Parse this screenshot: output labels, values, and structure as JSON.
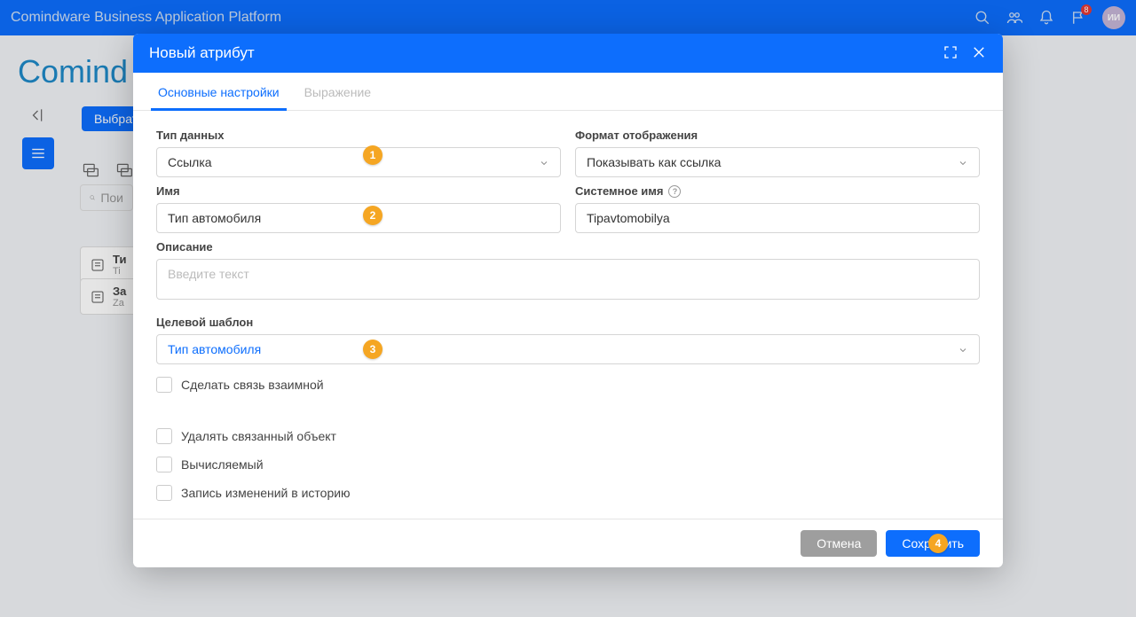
{
  "header": {
    "title": "Comindware Business Application Platform",
    "avatar_initials": "ИИ",
    "notif_count": "8"
  },
  "bg": {
    "logo_text": "Comind",
    "select_btn": "Выбрат",
    "search_placeholder": "Пои",
    "item1_title": "Ти",
    "item1_sub": "Ti",
    "item2_title": "За",
    "item2_sub": "Za"
  },
  "modal": {
    "title": "Новый атрибут",
    "tabs": {
      "main": "Основные настройки",
      "expression": "Выражение"
    },
    "labels": {
      "data_type": "Тип данных",
      "display_format": "Формат отображения",
      "name": "Имя",
      "system_name": "Системное имя",
      "description": "Описание",
      "target_template": "Целевой шаблон",
      "make_mutual": "Сделать связь взаимной",
      "delete_linked": "Удалять связанный объект",
      "computed": "Вычисляемый",
      "log_history": "Запись изменений в историю"
    },
    "values": {
      "data_type": "Ссылка",
      "display_format": "Показывать как ссылка",
      "name": "Тип автомобиля",
      "system_name": "Tipavtomobilya",
      "description_placeholder": "Введите текст",
      "target_template": "Тип автомобиля"
    },
    "footer": {
      "cancel": "Отмена",
      "save": "Сохранить"
    }
  },
  "annotations": {
    "a1": "1",
    "a2": "2",
    "a3": "3",
    "a4": "4"
  }
}
